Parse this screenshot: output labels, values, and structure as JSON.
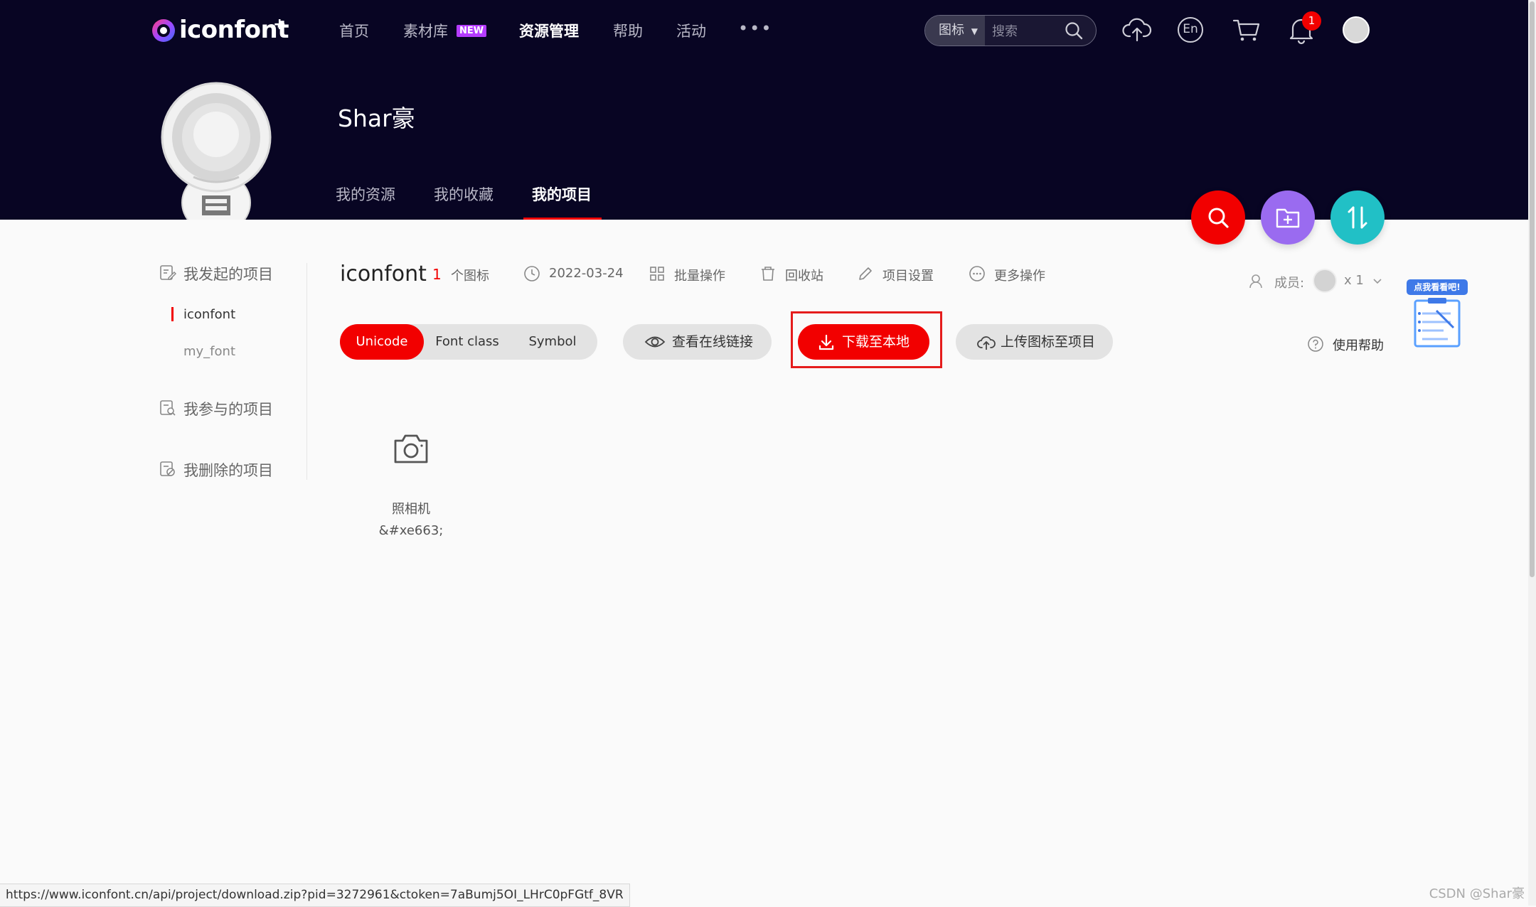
{
  "brand": {
    "logo_text": "iconfont",
    "logo_plus": "+"
  },
  "nav": {
    "items": [
      {
        "label": "首页"
      },
      {
        "label": "素材库"
      },
      {
        "label": "资源管理"
      },
      {
        "label": "帮助"
      },
      {
        "label": "活动"
      }
    ],
    "new_badge": "NEW",
    "more": "•••"
  },
  "search": {
    "type_selected": "图标",
    "placeholder": "搜索"
  },
  "header_icons": [
    "upload-cloud-icon",
    "language-en-icon",
    "cart-icon",
    "bell-icon",
    "avatar"
  ],
  "language_label": "En",
  "notifications": {
    "count": "1"
  },
  "user": {
    "name": "Shar豪"
  },
  "profile_tabs": [
    {
      "label": "我的资源"
    },
    {
      "label": "我的收藏"
    },
    {
      "label": "我的项目"
    }
  ],
  "fab": [
    "search-icon",
    "add-folder-icon",
    "sort-icon"
  ],
  "sidebar": {
    "created_heading": "我发起的项目",
    "projects": [
      {
        "label": "iconfont"
      },
      {
        "label": "my_font"
      }
    ],
    "joined_heading": "我参与的项目",
    "deleted_heading": "我删除的项目"
  },
  "project": {
    "title": "iconfont",
    "icon_count": "1",
    "icon_count_label": "个图标",
    "date": "2022-03-24",
    "actions": [
      {
        "label": "批量操作"
      },
      {
        "label": "回收站"
      },
      {
        "label": "项目设置"
      },
      {
        "label": "更多操作"
      }
    ],
    "members_label": "成员:",
    "members_count": "x 1",
    "help_label": "使用帮助"
  },
  "format_tabs": [
    {
      "label": "Unicode"
    },
    {
      "label": "Font class"
    },
    {
      "label": "Symbol"
    }
  ],
  "buttons": {
    "view_online": "查看在线链接",
    "download": "下载至本地",
    "upload": "上传图标至项目"
  },
  "promo": {
    "label": "点我看看吧!"
  },
  "icons": [
    {
      "name": "照相机",
      "code": "&#xe663;",
      "icon": "camera-icon"
    }
  ],
  "status_bar": {
    "url": "https://www.iconfont.cn/api/project/download.zip?pid=3272961&ctoken=7aBumj5OI_LHrC0pFGtf_8VR"
  },
  "watermark": "CSDN @Shar豪",
  "colors": {
    "header_bg": "#080523",
    "accent_red": "#f20000",
    "fab_purple": "#9a6bf0",
    "fab_teal": "#21c0c6",
    "new_badge": "#b53cff"
  }
}
